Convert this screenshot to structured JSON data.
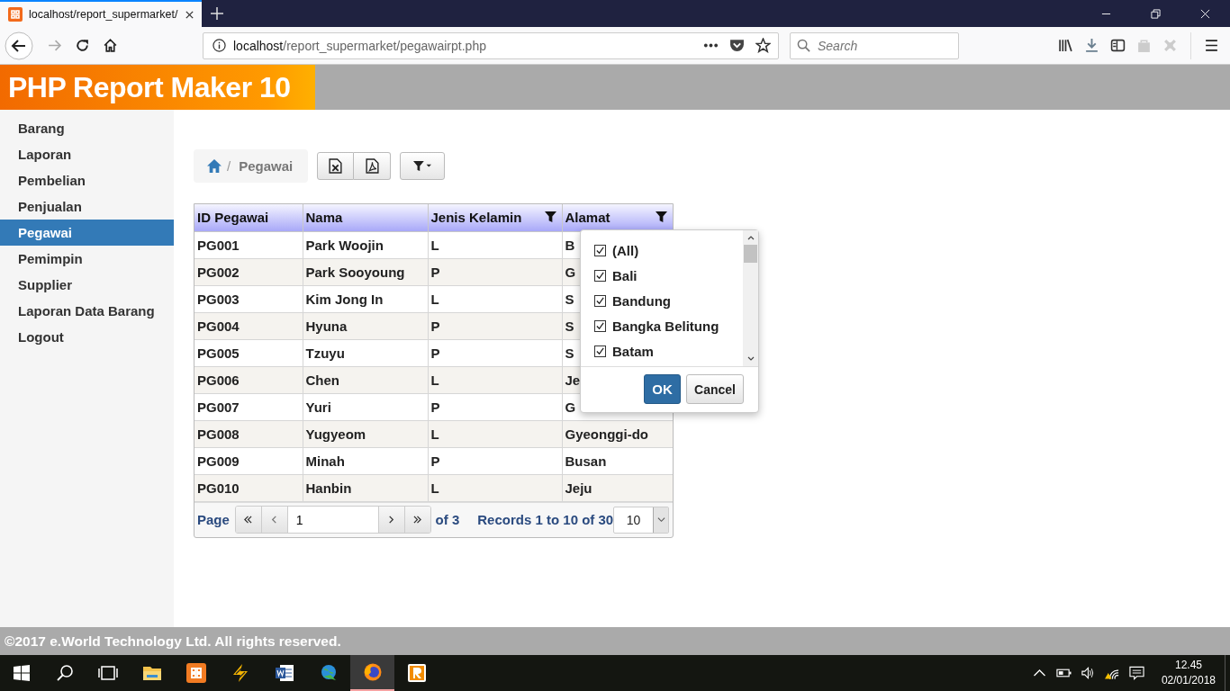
{
  "browser": {
    "tab_title": "localhost/report_supermarket/",
    "url_host": "localhost",
    "url_path": "/report_supermarket/pegawairpt.php",
    "search_placeholder": "Search"
  },
  "header": {
    "title": "PHP Report Maker 10"
  },
  "sidebar": {
    "items": [
      {
        "label": "Barang",
        "selected": false
      },
      {
        "label": "Laporan",
        "selected": false
      },
      {
        "label": "Pembelian",
        "selected": false
      },
      {
        "label": "Penjualan",
        "selected": false
      },
      {
        "label": "Pegawai",
        "selected": true
      },
      {
        "label": "Pemimpin",
        "selected": false
      },
      {
        "label": "Supplier",
        "selected": false
      },
      {
        "label": "Laporan Data Barang",
        "selected": false
      },
      {
        "label": "Logout",
        "selected": false
      }
    ]
  },
  "breadcrumb": {
    "separator": "/",
    "page": "Pegawai"
  },
  "table": {
    "columns": [
      {
        "label": "ID Pegawai",
        "filter": false
      },
      {
        "label": "Nama",
        "filter": false
      },
      {
        "label": "Jenis Kelamin",
        "filter": true
      },
      {
        "label": "Alamat",
        "filter": true
      }
    ],
    "rows": [
      [
        "PG001",
        "Park Woojin",
        "L",
        "B"
      ],
      [
        "PG002",
        "Park Sooyoung",
        "P",
        "G"
      ],
      [
        "PG003",
        "Kim Jong In",
        "L",
        "S"
      ],
      [
        "PG004",
        "Hyuna",
        "P",
        "S"
      ],
      [
        "PG005",
        "Tzuyu",
        "P",
        "S"
      ],
      [
        "PG006",
        "Chen",
        "L",
        "Je"
      ],
      [
        "PG007",
        "Yuri",
        "P",
        "G"
      ],
      [
        "PG008",
        "Yugyeom",
        "L",
        "Gyeonggi-do"
      ],
      [
        "PG009",
        "Minah",
        "P",
        "Busan"
      ],
      [
        "PG010",
        "Hanbin",
        "L",
        "Jeju"
      ]
    ]
  },
  "pager": {
    "label": "Page",
    "page": "1",
    "of_text": "of 3",
    "records": "Records 1 to 10 of 30",
    "page_size": "10"
  },
  "filter_popup": {
    "options": [
      {
        "label": "(All)",
        "checked": true
      },
      {
        "label": "Bali",
        "checked": true
      },
      {
        "label": "Bandung",
        "checked": true
      },
      {
        "label": "Bangka Belitung",
        "checked": true
      },
      {
        "label": "Batam",
        "checked": true
      }
    ],
    "ok": "OK",
    "cancel": "Cancel"
  },
  "footer": {
    "text": "©2017 e.World Technology Ltd. All rights reserved."
  },
  "taskbar": {
    "apps": [
      {
        "kind": "start",
        "active": false
      },
      {
        "kind": "search",
        "active": false
      },
      {
        "kind": "taskview",
        "active": false
      },
      {
        "kind": "folder",
        "active": false
      },
      {
        "kind": "tile",
        "active": false
      },
      {
        "kind": "bolt",
        "active": false
      },
      {
        "kind": "doc",
        "active": false
      },
      {
        "kind": "globe",
        "active": false
      },
      {
        "kind": "fox",
        "active": true
      },
      {
        "kind": "letter",
        "active": false
      }
    ],
    "time": "12.45",
    "date": "02/01/2018"
  }
}
